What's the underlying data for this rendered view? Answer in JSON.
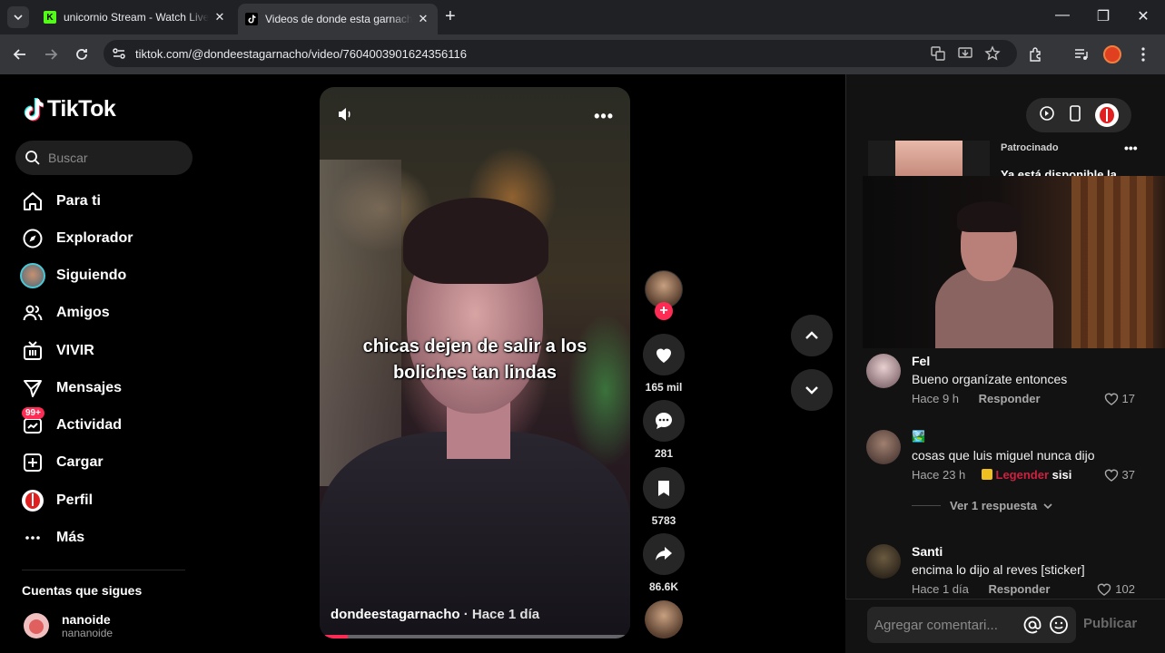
{
  "browser": {
    "tabs": [
      {
        "title": "unicornio Stream - Watch Live on Kick",
        "favicon_color": "#53fc18"
      },
      {
        "title": "Videos de donde esta garnacho",
        "favicon_color": "#000000"
      }
    ],
    "url": "tiktok.com/@dondeestagarnacho/video/7604003901624356116"
  },
  "sidebar": {
    "logo_text": "TikTok",
    "search_placeholder": "Buscar",
    "nav": [
      {
        "label": "Para ti",
        "icon": "home-icon"
      },
      {
        "label": "Explorador",
        "icon": "compass-icon"
      },
      {
        "label": "Siguiendo",
        "icon": "following-avatar-icon"
      },
      {
        "label": "Amigos",
        "icon": "friends-icon"
      },
      {
        "label": "VIVIR",
        "icon": "live-tv-icon"
      },
      {
        "label": "Mensajes",
        "icon": "send-icon"
      },
      {
        "label": "Actividad",
        "icon": "activity-icon",
        "badge": "99+"
      },
      {
        "label": "Cargar",
        "icon": "upload-plus-icon"
      },
      {
        "label": "Perfil",
        "icon": "profile-avatar-icon"
      },
      {
        "label": "Más",
        "icon": "more-dots-icon"
      }
    ],
    "following_title": "Cuentas que sigues",
    "following": [
      {
        "name": "nanoide",
        "handle": "nananoide"
      }
    ]
  },
  "video": {
    "caption": "chicas dejen de salir a los boliches tan lindas",
    "author": "dondeestagarnacho",
    "time": "Hace 1 día",
    "progress": 0.09
  },
  "actions": {
    "likes": "165 mil",
    "comments": "281",
    "saves": "5783",
    "shares": "86.6K"
  },
  "right_panel": {
    "ad": {
      "label": "Patrocinado",
      "text": "Ya está disponible la"
    },
    "comments": [
      {
        "user": "Fel",
        "text": "Bueno organízate entonces",
        "time": "Hace 9 h",
        "reply": "Responder",
        "likes": "17"
      },
      {
        "user": "🏞️",
        "text": "cosas que luis miguel nunca dijo",
        "time": "Hace 23 h",
        "tag": "Legender",
        "tag_extra": "sisi",
        "likes": "37"
      },
      {
        "user": "Santi",
        "text": "encima lo dijo al reves [sticker]",
        "time": "Hace 1 día",
        "reply": "Responder",
        "likes": "102"
      }
    ],
    "view_replies": "Ver 1 respuesta",
    "comment_placeholder": "Agregar comentari...",
    "publish_label": "Publicar"
  },
  "colors": {
    "accent": "#fe2c55",
    "background": "#000000",
    "panel": "#121212"
  }
}
